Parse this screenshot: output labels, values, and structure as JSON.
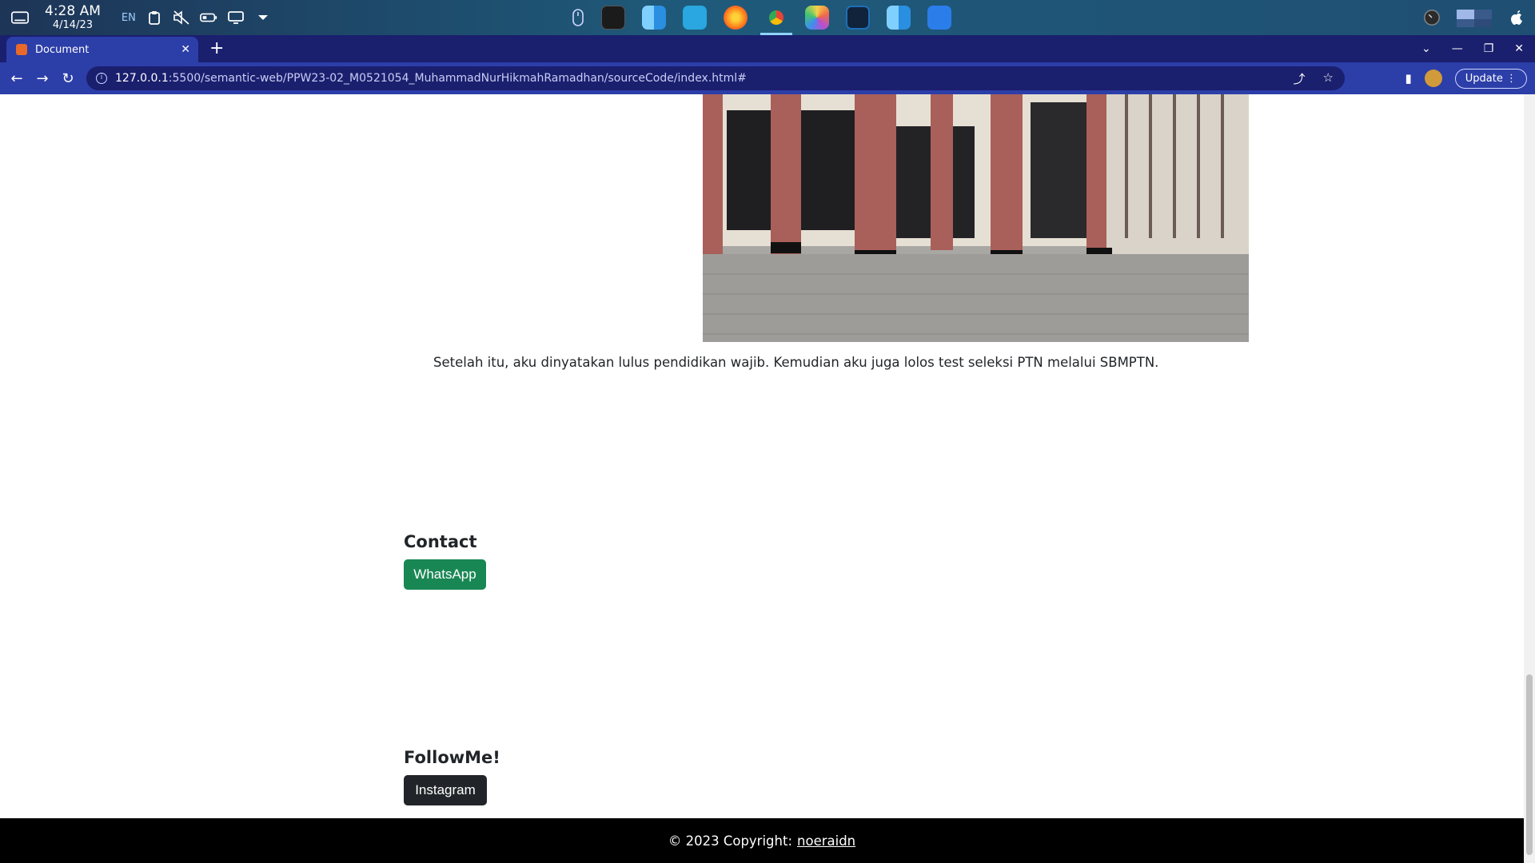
{
  "os": {
    "time": "4:28 AM",
    "date": "4/14/23",
    "lang": "EN",
    "dock_apps": [
      {
        "name": "terminal-app",
        "color": "#1b1b1b"
      },
      {
        "name": "finder-app",
        "color": "#3aa3f0"
      },
      {
        "name": "kite-app",
        "color": "#2aa6e0"
      },
      {
        "name": "firefox-app",
        "color": "#ff7a1a"
      },
      {
        "name": "chrome-app",
        "color": "#e8eaed"
      },
      {
        "name": "photos-app",
        "color": "#f5d24a"
      },
      {
        "name": "vscode-app",
        "color": "#1e6fb8"
      },
      {
        "name": "finder-app-2",
        "color": "#3aa3f0"
      },
      {
        "name": "wps-app",
        "color": "#2b7de9"
      }
    ]
  },
  "browser": {
    "tab_title": "Document",
    "url_host": "127.0.0.1",
    "url_path": ":5500/semantic-web/PPW23-02_M0521054_MuhammadNurHikmahRamadhan/sourceCode/index.html#",
    "update_label": "Update"
  },
  "page": {
    "story_text": "Setelah itu, aku dinyatakan lulus pendidikan wajib. Kemudian aku juga lolos test seleksi PTN melalui SBMPTN.",
    "contact": {
      "title": "Contact",
      "whatsapp_label": "WhatsApp",
      "whatsapp_color": "#198754"
    },
    "follow": {
      "title": "FollowMe!",
      "instagram_label": "Instagram",
      "instagram_color": "#212529"
    },
    "footer": {
      "text": "© 2023 Copyright:",
      "link": "noeraidn"
    }
  }
}
